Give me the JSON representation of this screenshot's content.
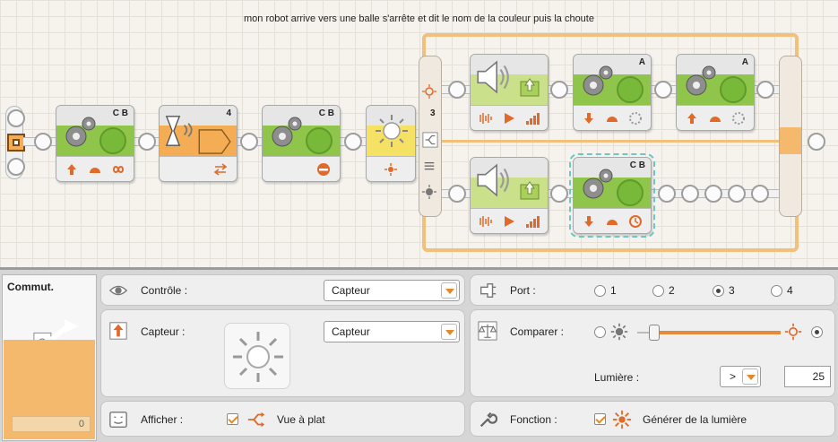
{
  "canvas": {
    "comment": "mon robot arrive vers une balle s'arrête et dit le nom de la couleur puis la choute",
    "blocks": [
      {
        "name": "move-block-1",
        "ports": "C B",
        "type": "move"
      },
      {
        "name": "wait-sound-block",
        "ports": "4",
        "type": "wait"
      },
      {
        "name": "move-block-2",
        "ports": "C B",
        "type": "move"
      },
      {
        "name": "switch-light-block",
        "ports": "3",
        "type": "switch"
      },
      {
        "name": "sound-block-top",
        "ports": "",
        "type": "sound"
      },
      {
        "name": "motor-block-top-1",
        "ports": "A",
        "type": "motor"
      },
      {
        "name": "motor-block-top-2",
        "ports": "A",
        "type": "motor"
      },
      {
        "name": "sound-block-bottom",
        "ports": "",
        "type": "sound"
      },
      {
        "name": "move-block-bottom",
        "ports": "C B",
        "type": "move"
      }
    ]
  },
  "panel": {
    "block_title": "Commut.",
    "block_counter": "0",
    "control_label": "Contrôle :",
    "control_value": "Capteur",
    "sensor_label": "Capteur :",
    "sensor_value": "Capteur",
    "display_label": "Afficher :",
    "display_option": "Vue à plat",
    "port_label": "Port :",
    "port_options": [
      "1",
      "2",
      "3",
      "4"
    ],
    "port_selected": "3",
    "compare_label": "Comparer :",
    "compare_slider_percent": 12,
    "light_label": "Lumière :",
    "light_operator": ">",
    "light_value": "25",
    "function_label": "Fonction :",
    "function_option": "Générer de la lumière"
  },
  "colors": {
    "accent_orange": "#f4ac55",
    "move_green": "#8fc54a",
    "light_yellow": "#f5e163",
    "switch_frame": "#f1c07b"
  },
  "icons": [
    "gear-icon",
    "sound-icon",
    "light-sensor-icon",
    "eye-icon",
    "port-icon",
    "scale-icon",
    "wrench-icon",
    "display-icon",
    "switch-icon"
  ]
}
